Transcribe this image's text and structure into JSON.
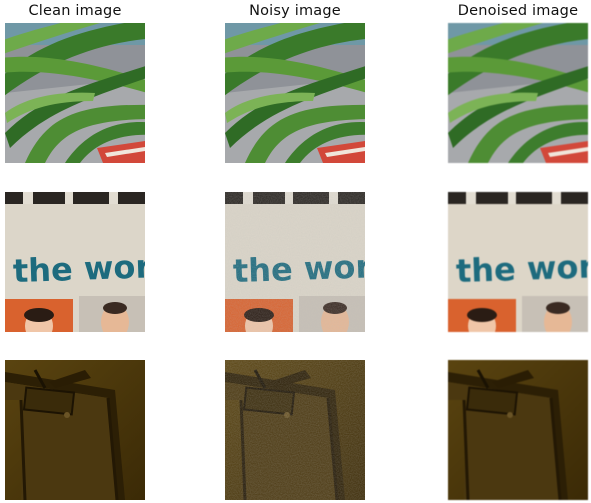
{
  "columns": [
    {
      "title": "Clean image"
    },
    {
      "title": "Noisy image"
    },
    {
      "title": "Denoised image"
    }
  ],
  "rows": [
    {
      "subject": "plant"
    },
    {
      "subject": "poster",
      "text": "the worl"
    },
    {
      "subject": "door"
    }
  ],
  "colors": {
    "background": "#ffffff",
    "poster_text": "#1d6b7e",
    "leaf": "#3f7f2c",
    "door_wall": "#4a3608"
  }
}
